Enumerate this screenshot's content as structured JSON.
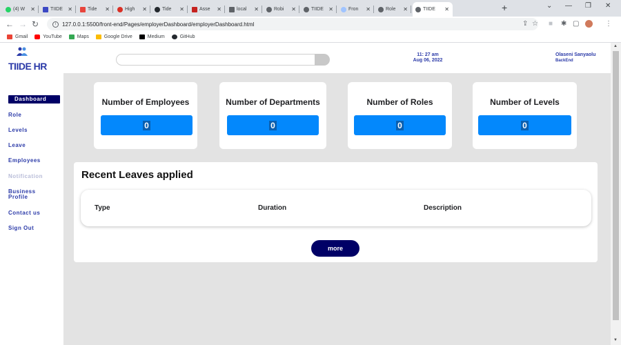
{
  "browser": {
    "tabs": [
      {
        "label": "(4) W",
        "color": "#25d366"
      },
      {
        "label": "TIIDE",
        "color": "#3b48c4"
      },
      {
        "label": "Tide",
        "color": "#e8453c"
      },
      {
        "label": "High",
        "color": "#d93025"
      },
      {
        "label": "Tide",
        "color": "#24292e"
      },
      {
        "label": "Asse",
        "color": "#c5221f"
      },
      {
        "label": "local",
        "color": "#5f6368"
      },
      {
        "label": "Robi",
        "color": "#5f6368"
      },
      {
        "label": "TIIDE",
        "color": "#5f6368"
      },
      {
        "label": "Fron",
        "color": "#a0c4ff"
      },
      {
        "label": "Role",
        "color": "#5f6368"
      },
      {
        "label": "TIIDE",
        "color": "#5f6368"
      }
    ],
    "url": "127.0.0.1:5500/front-end/Pages/employerDashboard/employerDashboard.html",
    "bookmarks": [
      {
        "label": "Gmail",
        "color": "#ea4335"
      },
      {
        "label": "YouTube",
        "color": "#ff0000"
      },
      {
        "label": "Maps",
        "color": "#34a853"
      },
      {
        "label": "Google Drive",
        "color": "#fbbc04"
      },
      {
        "label": "Medium",
        "color": "#000000"
      },
      {
        "label": "GitHub",
        "color": "#24292e"
      }
    ]
  },
  "header": {
    "brand": "TIIDE HR",
    "time": "11: 27 am",
    "date": "Aug 06, 2022",
    "user_name": "Olaseni Sanyaolu",
    "user_role": "BackEnd"
  },
  "sidebar": {
    "items": [
      {
        "label": "Dashboard"
      },
      {
        "label": "Role"
      },
      {
        "label": "Levels"
      },
      {
        "label": "Leave"
      },
      {
        "label": "Employees"
      },
      {
        "label": "Notification"
      },
      {
        "label": "Business Profile"
      },
      {
        "label": "Contact us"
      },
      {
        "label": "Sign Out"
      }
    ]
  },
  "stats": [
    {
      "title": "Number of Employees",
      "value": "0"
    },
    {
      "title": "Number of Departments",
      "value": "0"
    },
    {
      "title": "Number of Roles",
      "value": "0"
    },
    {
      "title": "Number of Levels",
      "value": "0"
    }
  ],
  "leaves": {
    "heading": "Recent Leaves applied",
    "columns": [
      "Type",
      "Duration",
      "Description"
    ],
    "more_label": "more"
  },
  "colors": {
    "brand": "#2b3aa8",
    "nav_active": "#000066",
    "stat_value": "#0388fc",
    "main_bg": "#e3e3e3"
  }
}
